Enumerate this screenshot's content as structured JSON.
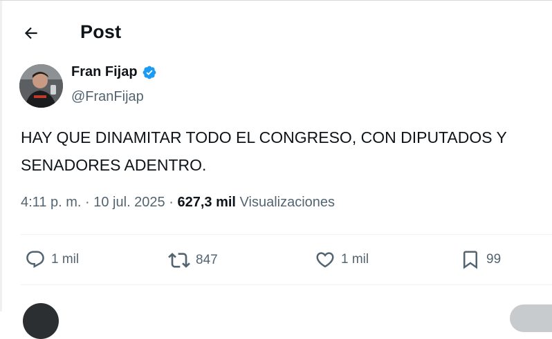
{
  "header": {
    "title": "Post",
    "back_icon": "arrow-left-icon"
  },
  "author": {
    "display_name": "Fran Fijap",
    "handle": "@FranFijap",
    "verified_icon": "verified-badge-icon",
    "verified_color": "#1d9bf0"
  },
  "tweet": {
    "text_line1": "HAY QUE DINAMITAR TODO EL CONGRESO, CON DIPUTADOS Y",
    "text_line2": "SENADORES ADENTRO."
  },
  "meta": {
    "time": "4:11 p. m.",
    "separator": "·",
    "date": "10 jul. 2025",
    "views_count": "627,3 mil",
    "views_label": "Visualizaciones"
  },
  "actions": {
    "replies": {
      "icon": "reply-icon",
      "count": "1 mil"
    },
    "reposts": {
      "icon": "repost-icon",
      "count": "847"
    },
    "likes": {
      "icon": "heart-icon",
      "count": "1 mil"
    },
    "bookmarks": {
      "icon": "bookmark-icon",
      "count": "99"
    }
  },
  "colors": {
    "text_primary": "#0f1419",
    "text_secondary": "#536471",
    "divider": "#eff3f4"
  }
}
